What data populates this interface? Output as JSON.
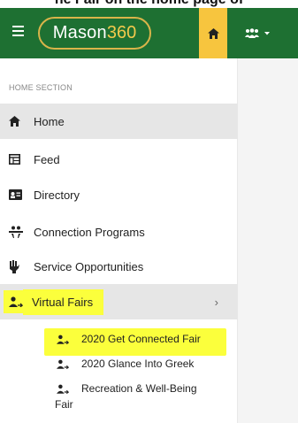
{
  "caption": "he Fair on the home page of",
  "header": {
    "logo_main": "Mason",
    "logo_accent": "360"
  },
  "sidebar": {
    "section_title": "HOME SECTION",
    "items": [
      {
        "label": "Home",
        "icon": "home-icon"
      },
      {
        "label": "Feed",
        "icon": "feed-icon"
      },
      {
        "label": "Directory",
        "icon": "directory-icon"
      },
      {
        "label": "Connection Programs",
        "icon": "connection-icon"
      },
      {
        "label": "Service Opportunities",
        "icon": "hand-icon"
      },
      {
        "label": "Virtual Fairs",
        "icon": "fair-icon",
        "chevron": "›"
      }
    ],
    "subitems": [
      {
        "label": "2020 Get Connected Fair"
      },
      {
        "label": "2020 Glance Into Greek"
      },
      {
        "label_line1": "Recreation & Well-Being",
        "label_line2": "Fair"
      }
    ]
  },
  "colors": {
    "header": "#1e7032",
    "home_tab": "#f7c53e",
    "highlight": "#fbff3c",
    "logo_ring": "#d9b44a"
  }
}
